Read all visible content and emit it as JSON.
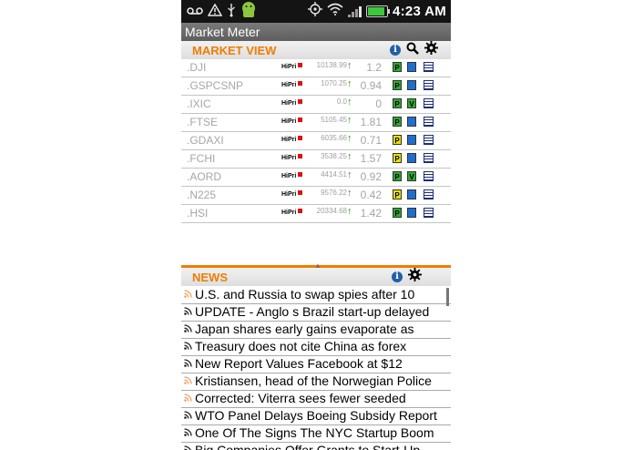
{
  "status_bar": {
    "time": "4:23 AM",
    "icons": [
      "voicemail-icon",
      "warning-icon",
      "usb-icon",
      "android-icon",
      "gps-icon",
      "wifi-icon",
      "signal-icon",
      "battery-icon"
    ]
  },
  "app": {
    "title": "Market Meter"
  },
  "market_view": {
    "title": "MARKET VIEW",
    "header_icons": [
      "info-icon",
      "search-icon",
      "gear-icon"
    ],
    "rows": [
      {
        "symbol": ".DJI",
        "priority": "HiPri",
        "price": "10138.99",
        "change": "1.2",
        "p_color": "#2eaa2e",
        "v_color": "#1f6fd0"
      },
      {
        "symbol": ".GSPCSNP",
        "priority": "HiPri",
        "price": "1070.25",
        "change": "0.94",
        "p_color": "#2eaa2e",
        "v_color": "#1f6fd0"
      },
      {
        "symbol": ".IXIC",
        "priority": "HiPri",
        "price": "0.0",
        "change": "0",
        "p_color": "#2eaa2e",
        "v_color": "#2eaa2e"
      },
      {
        "symbol": ".FTSE",
        "priority": "HiPri",
        "price": "5105.45",
        "change": "1.81",
        "p_color": "#2eaa2e",
        "v_color": "#1f6fd0"
      },
      {
        "symbol": ".GDAXI",
        "priority": "HiPri",
        "price": "6035.66",
        "change": "0.71",
        "p_color": "#e8e000",
        "v_color": "#1f6fd0"
      },
      {
        "symbol": ".FCHI",
        "priority": "HiPri",
        "price": "3538.25",
        "change": "1.57",
        "p_color": "#e8e000",
        "v_color": "#1f6fd0"
      },
      {
        "symbol": ".AORD",
        "priority": "HiPri",
        "price": "4414.51",
        "change": "0.92",
        "p_color": "#2eaa2e",
        "v_color": "#2eaa2e"
      },
      {
        "symbol": ".N225",
        "priority": "HiPri",
        "price": "9576.22",
        "change": "0.42",
        "p_color": "#e8e000",
        "v_color": "#1f6fd0"
      },
      {
        "symbol": ".HSI",
        "priority": "HiPri",
        "price": "20334.68",
        "change": "1.42",
        "p_color": "#2eaa2e",
        "v_color": "#1f6fd0"
      }
    ],
    "badge_p": "P",
    "badge_v": "V"
  },
  "news": {
    "title": "NEWS",
    "header_icons": [
      "info-icon",
      "gear-icon"
    ],
    "items": [
      {
        "headline": "U.S. and Russia to swap spies after 10",
        "icon": "orange"
      },
      {
        "headline": "UPDATE - Anglo s Brazil start-up delayed",
        "icon": "dark"
      },
      {
        "headline": "Japan shares early gains evaporate as",
        "icon": "dark"
      },
      {
        "headline": "Treasury does not cite China as forex",
        "icon": "dark"
      },
      {
        "headline": "New Report Values Facebook at $12",
        "icon": "dark"
      },
      {
        "headline": "Kristiansen, head of the Norwegian Police",
        "icon": "orange"
      },
      {
        "headline": "Corrected: Viterra sees fewer seeded",
        "icon": "orange"
      },
      {
        "headline": "WTO Panel Delays Boeing Subsidy Report",
        "icon": "dark"
      },
      {
        "headline": "One Of The Signs The NYC Startup Boom",
        "icon": "dark"
      },
      {
        "headline": "Big Companies Offer Grants to Start-Up",
        "icon": "dark"
      }
    ]
  },
  "colors": {
    "accent": "#f07d00",
    "up_arrow": "#2e9a1e"
  }
}
